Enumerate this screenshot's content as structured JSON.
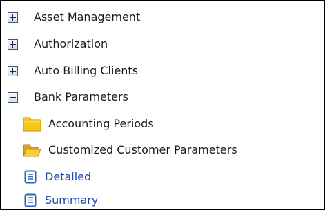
{
  "tree": {
    "items": [
      {
        "label": "Asset Management",
        "state": "collapsed",
        "icon": "plus-box-icon"
      },
      {
        "label": "Authorization",
        "state": "collapsed",
        "icon": "plus-box-icon"
      },
      {
        "label": "Auto Billing Clients",
        "state": "collapsed",
        "icon": "plus-box-icon"
      },
      {
        "label": "Bank Parameters",
        "state": "expanded",
        "icon": "minus-box-icon",
        "children": [
          {
            "label": "Accounting Periods",
            "icon": "folder-closed-icon"
          },
          {
            "label": "Customized Customer Parameters",
            "icon": "folder-open-icon",
            "children": [
              {
                "label": "Detailed",
                "icon": "document-icon"
              },
              {
                "label": "Summary",
                "icon": "document-icon"
              }
            ]
          }
        ]
      }
    ]
  },
  "colors": {
    "border": "#000000",
    "text": "#1a1a1a",
    "link": "#1f47b4",
    "folder": "#f5c518",
    "document": "#2e62b8"
  }
}
